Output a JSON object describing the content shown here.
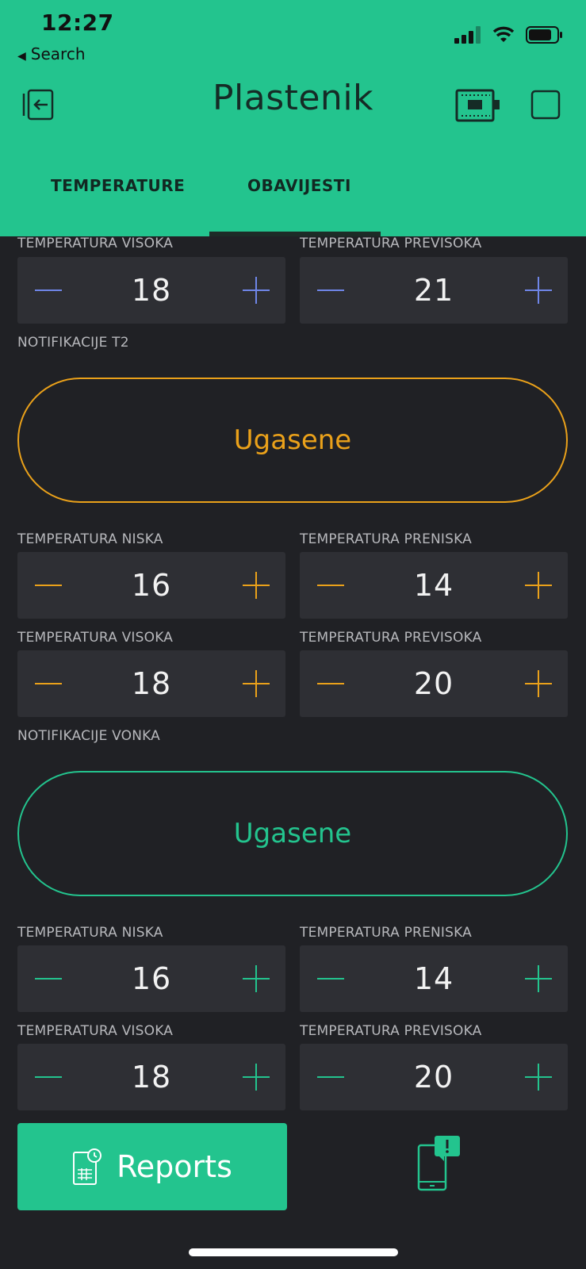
{
  "status_bar": {
    "time": "12:27",
    "back_label": "Search"
  },
  "header": {
    "title": "Plastenik",
    "tabs": [
      {
        "label": "TEMPERATURE"
      },
      {
        "label": "OBAVIJESTI"
      }
    ]
  },
  "section_t1": {
    "visoka": {
      "label": "TEMPERATURA VISOKA",
      "value": "18"
    },
    "previsoka": {
      "label": "TEMPERATURA PREVISOKA",
      "value": "21"
    }
  },
  "section_t2": {
    "notif_label": "NOTIFIKACIJE T2",
    "toggle_label": "Ugasene",
    "niska": {
      "label": "TEMPERATURA NISKA",
      "value": "16"
    },
    "preniska": {
      "label": "TEMPERATURA PRENISKA",
      "value": "14"
    },
    "visoka": {
      "label": "TEMPERATURA VISOKA",
      "value": "18"
    },
    "previsoka": {
      "label": "TEMPERATURA PREVISOKA",
      "value": "20"
    }
  },
  "section_vonka": {
    "notif_label": "NOTIFIKACIJE VONKA",
    "toggle_label": "Ugasene",
    "niska": {
      "label": "TEMPERATURA NISKA",
      "value": "16"
    },
    "preniska": {
      "label": "TEMPERATURA PRENISKA",
      "value": "14"
    },
    "visoka": {
      "label": "TEMPERATURA VISOKA",
      "value": "18"
    },
    "previsoka": {
      "label": "TEMPERATURA PREVISOKA",
      "value": "20"
    }
  },
  "footer": {
    "reports_label": "Reports"
  },
  "colors": {
    "accent": "#23c48e",
    "blue": "#6f86e8",
    "orange": "#eaa11a",
    "background": "#202125"
  },
  "icons": [
    "back-arrow-icon",
    "signal-icon",
    "wifi-icon",
    "battery-icon",
    "exit-icon",
    "device-board-icon",
    "stop-square-icon",
    "reports-icon",
    "phone-notification-icon"
  ]
}
